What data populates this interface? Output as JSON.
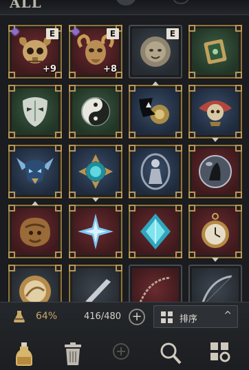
{
  "header": {
    "title": "ALL"
  },
  "inventory": {
    "slots": [
      {
        "name": "slot-red-skull-horns",
        "bg": "red",
        "badge": "E",
        "gem": true,
        "upgrade": "+9"
      },
      {
        "name": "slot-red-ram-skull",
        "bg": "red",
        "badge": "E",
        "gem": true,
        "upgrade": "+8"
      },
      {
        "name": "slot-slate-beast-head",
        "bg": "slate",
        "badge": "E",
        "gem": false,
        "upgrade": ""
      },
      {
        "name": "slot-green-card-box",
        "bg": "green",
        "badge": "",
        "gem": false,
        "upgrade": ""
      },
      {
        "name": "slot-green-mask",
        "bg": "green",
        "badge": "",
        "gem": false,
        "upgrade": ""
      },
      {
        "name": "slot-green-yin-yang",
        "bg": "green",
        "badge": "",
        "gem": false,
        "upgrade": ""
      },
      {
        "name": "slot-blue-dark-emblem",
        "bg": "blue",
        "badge": "",
        "gem": false,
        "upgrade": ""
      },
      {
        "name": "slot-blue-skull-ornament",
        "bg": "blue",
        "badge": "",
        "gem": false,
        "upgrade": ""
      },
      {
        "name": "slot-blue-demon-crest",
        "bg": "blue",
        "badge": "",
        "gem": false,
        "upgrade": ""
      },
      {
        "name": "slot-blue-teal-orb",
        "bg": "blue",
        "badge": "",
        "gem": false,
        "upgrade": ""
      },
      {
        "name": "slot-blue-silver-statue",
        "bg": "blue",
        "badge": "",
        "gem": false,
        "upgrade": ""
      },
      {
        "name": "slot-red-crystal-ball",
        "bg": "red",
        "badge": "",
        "gem": false,
        "upgrade": ""
      },
      {
        "name": "slot-red-beast-relic",
        "bg": "red",
        "badge": "",
        "gem": false,
        "upgrade": ""
      },
      {
        "name": "slot-red-ice-star",
        "bg": "red",
        "badge": "",
        "gem": false,
        "upgrade": ""
      },
      {
        "name": "slot-red-cyan-diamond",
        "bg": "red",
        "badge": "",
        "gem": false,
        "upgrade": ""
      },
      {
        "name": "slot-red-pocket-watch",
        "bg": "red",
        "badge": "",
        "gem": false,
        "upgrade": ""
      },
      {
        "name": "slot-slate-gold-disc",
        "bg": "slate",
        "badge": "",
        "gem": false,
        "upgrade": ""
      },
      {
        "name": "slot-slate-blade",
        "bg": "slate",
        "badge": "",
        "gem": false,
        "upgrade": ""
      },
      {
        "name": "slot-red-chain-whip",
        "bg": "red",
        "badge": "",
        "gem": false,
        "upgrade": ""
      },
      {
        "name": "slot-slate-bow",
        "bg": "slate",
        "badge": "",
        "gem": false,
        "upgrade": ""
      }
    ]
  },
  "footer": {
    "weight_percent": "64%",
    "capacity": "416/480",
    "add_symbol": "+",
    "sort_label": "排序",
    "sort_chevron": "^"
  },
  "tools": [
    {
      "name": "potion-icon"
    },
    {
      "name": "trash-icon"
    },
    {
      "name": "plus-circle-icon"
    },
    {
      "name": "magnifier-icon"
    },
    {
      "name": "grid-settings-icon"
    }
  ],
  "colors": {
    "frame_gold": "#8d7444",
    "bg_red": "#6a2b2f",
    "bg_green": "#3d5e45",
    "bg_blue": "#3a4d68",
    "bg_slate": "#3e4650",
    "weight_text": "#c7a86a"
  }
}
